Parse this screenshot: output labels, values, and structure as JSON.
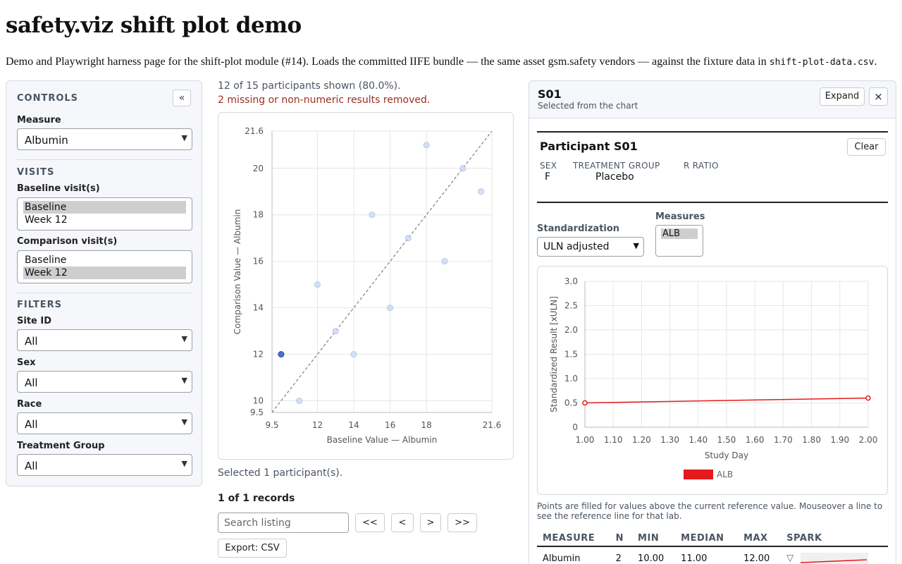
{
  "page": {
    "title": "safety.viz shift plot demo",
    "intro_text": "Demo and Playwright harness page for the shift-plot module (#14). Loads the committed IIFE bundle — the same asset gsm.safety vendors — against the fixture data in ",
    "intro_file": "shift-plot-data.csv",
    "intro_end": "."
  },
  "controls": {
    "heading": "CONTROLS",
    "collapse_label": "«",
    "measure_label": "Measure",
    "measure_value": "Albumin",
    "visits_heading": "VISITS",
    "baseline_label": "Baseline visit(s)",
    "baseline_options": [
      "Baseline",
      "Week 12"
    ],
    "comparison_label": "Comparison visit(s)",
    "comparison_options": [
      "Baseline",
      "Week 12"
    ],
    "filters_heading": "FILTERS",
    "site_label": "Site ID",
    "site_value": "All",
    "sex_label": "Sex",
    "sex_value": "All",
    "race_label": "Race",
    "race_value": "All",
    "treatment_label": "Treatment Group",
    "treatment_value": "All"
  },
  "status": {
    "shown": "12 of 15 participants shown (80.0%).",
    "removed": "2 missing or non-numeric results removed.",
    "selected": "Selected 1 participant(s).",
    "records": "1 of 1 records"
  },
  "listing": {
    "search_placeholder": "Search listing",
    "first": "<<",
    "prev": "<",
    "next": ">",
    "last": ">>",
    "export": "Export: CSV"
  },
  "chart_data": [
    {
      "type": "scatter",
      "xlabel": "Baseline Value — Albumin",
      "ylabel": "Comparison Value — Albumin",
      "xlim": [
        9.5,
        21.6
      ],
      "ylim": [
        9.5,
        21.6
      ],
      "x_ticks": [
        "9.5",
        "12",
        "14",
        "16",
        "18",
        "21.6"
      ],
      "y_ticks": [
        "9.5",
        "10",
        "12",
        "14",
        "16",
        "18",
        "20",
        "21.6"
      ],
      "points": [
        {
          "x": 10,
          "y": 12,
          "selected": true
        },
        {
          "x": 11,
          "y": 10
        },
        {
          "x": 12,
          "y": 15
        },
        {
          "x": 13,
          "y": 13
        },
        {
          "x": 14,
          "y": 12
        },
        {
          "x": 15,
          "y": 18
        },
        {
          "x": 16,
          "y": 14
        },
        {
          "x": 17,
          "y": 17
        },
        {
          "x": 18,
          "y": 21
        },
        {
          "x": 19,
          "y": 16
        },
        {
          "x": 20,
          "y": 20
        },
        {
          "x": 21,
          "y": 19
        }
      ],
      "reference_line": "identity",
      "grid": true
    },
    {
      "type": "line",
      "xlabel": "Study Day",
      "ylabel": "Standardized Result [xULN]",
      "xlim": [
        1.0,
        2.0
      ],
      "ylim": [
        0,
        3.0
      ],
      "x_ticks": [
        "1.00",
        "1.10",
        "1.20",
        "1.30",
        "1.40",
        "1.50",
        "1.60",
        "1.70",
        "1.80",
        "1.90",
        "2.00"
      ],
      "y_ticks": [
        "0",
        "0.5",
        "1.0",
        "1.5",
        "2.0",
        "2.5",
        "3.0"
      ],
      "series": [
        {
          "name": "ALB",
          "color": "#e41a1c",
          "x": [
            1.0,
            2.0
          ],
          "y": [
            0.5,
            0.6
          ]
        }
      ],
      "legend": "bottom"
    }
  ],
  "detail": {
    "id": "S01",
    "subtitle": "Selected from the chart",
    "expand": "Expand",
    "close": "×",
    "participant_title": "Participant S01",
    "clear": "Clear",
    "sex_h": "SEX",
    "sex_v": "F",
    "trt_h": "TREATMENT GROUP",
    "trt_v": "Placebo",
    "ratio_h": "R RATIO",
    "std_label": "Standardization",
    "std_value": "ULN adjusted",
    "measures_label": "Measures",
    "measures_option": "ALB",
    "note": "Points are filled for values above the current reference value. Mouseover a line to see the reference line for that lab.",
    "table": {
      "headers": [
        "MEASURE",
        "N",
        "MIN",
        "MEDIAN",
        "MAX",
        "SPARK"
      ],
      "row": {
        "measure": "Albumin",
        "n": "2",
        "min": "10.00",
        "median": "11.00",
        "max": "12.00",
        "spark_icon": "▽"
      }
    }
  },
  "colors": {
    "accent": "#4a72c9",
    "series": "#e41a1c",
    "warning_text": "#9c2d1f"
  }
}
